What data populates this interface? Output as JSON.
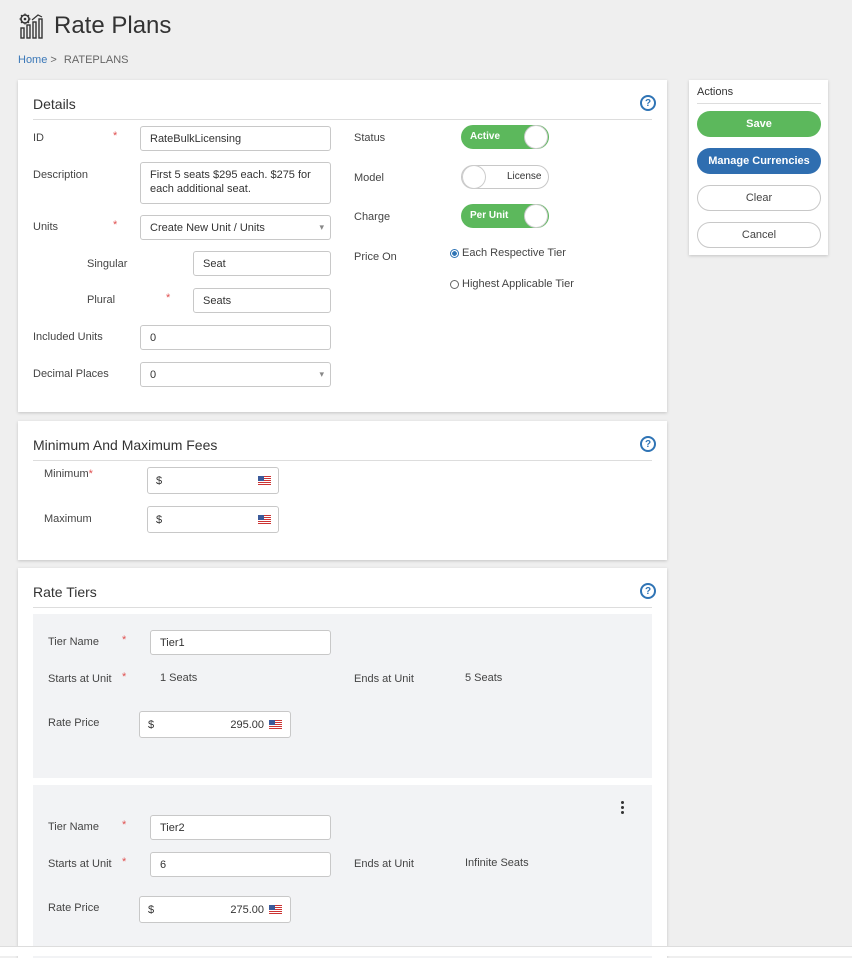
{
  "page": {
    "title": "Rate Plans",
    "breadcrumb": {
      "home": "Home",
      "separator": ">",
      "current": "RATEPLANS"
    }
  },
  "details": {
    "title": "Details",
    "id_label": "ID",
    "id_value": "RateBulkLicensing",
    "description_label": "Description",
    "description_value": "First 5 seats $295 each. $275 for each additional seat.",
    "units_label": "Units",
    "units_value": "Create New Unit / Units",
    "singular_label": "Singular",
    "singular_value": "Seat",
    "plural_label": "Plural",
    "plural_value": "Seats",
    "included_units_label": "Included Units",
    "included_units_value": "0",
    "decimal_places_label": "Decimal Places",
    "decimal_places_value": "0",
    "status_label": "Status",
    "status_toggle": "Active",
    "model_label": "Model",
    "model_toggle": "License",
    "charge_label": "Charge",
    "charge_toggle": "Per Unit",
    "price_on_label": "Price On",
    "price_on_options": [
      "Each Respective Tier",
      "Highest Applicable Tier"
    ],
    "price_on_selected": "Each Respective Tier",
    "required_mark": "*"
  },
  "fees": {
    "title": "Minimum And Maximum Fees",
    "minimum_label": "Minimum",
    "maximum_label": "Maximum",
    "currency_symbol": "$"
  },
  "rate_tiers": {
    "title": "Rate Tiers",
    "tier_name_label": "Tier Name",
    "starts_label": "Starts at Unit",
    "ends_label": "Ends at Unit",
    "rate_price_label": "Rate Price",
    "currency_symbol": "$",
    "tiers": [
      {
        "name": "Tier1",
        "starts": "1 Seats",
        "ends": "5 Seats",
        "price": "295.00"
      },
      {
        "name": "Tier2",
        "starts": "6",
        "ends": "Infinite Seats",
        "price": "275.00"
      }
    ]
  },
  "actions": {
    "title": "Actions",
    "save": "Save",
    "manage_currencies": "Manage Currencies",
    "clear": "Clear",
    "cancel": "Cancel"
  },
  "icons": {
    "title_icon": "settings-chart-icon",
    "help_icon": "question-circle-icon",
    "flag_icon": "us-flag-icon",
    "kebab_icon": "more-vertical-icon"
  },
  "colors": {
    "accent_green": "#5cb85c",
    "accent_blue": "#2f6eb0",
    "required_red": "#e05050",
    "link_blue": "#3b78b8"
  }
}
